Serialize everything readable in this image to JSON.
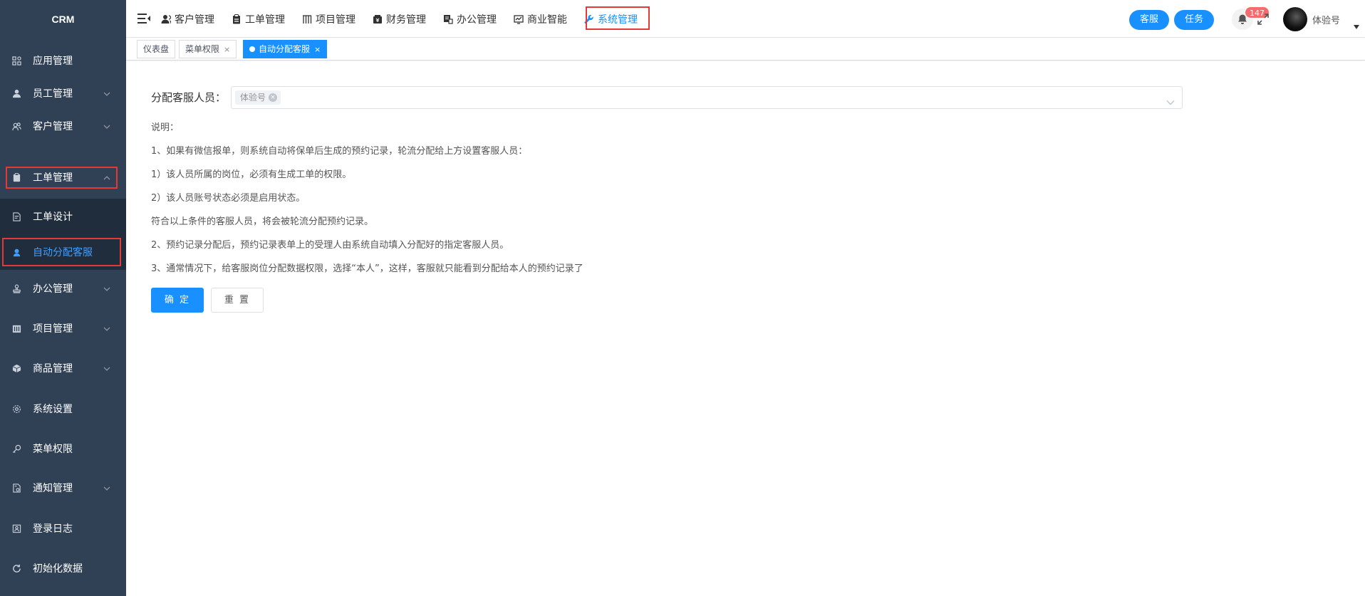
{
  "sidebar": {
    "brand": "CRM",
    "items": [
      {
        "label": "应用管理",
        "icon": "apps-grid-icon"
      },
      {
        "label": "员工管理",
        "icon": "user-icon"
      },
      {
        "label": "客户管理",
        "icon": "customers-icon"
      },
      {
        "label": "工单管理",
        "icon": "clipboard-icon"
      },
      {
        "label": "办公管理",
        "icon": "stamp-icon"
      },
      {
        "label": "项目管理",
        "icon": "building-icon"
      },
      {
        "label": "商品管理",
        "icon": "cube-icon"
      },
      {
        "label": "系统设置",
        "icon": "gear-icon"
      },
      {
        "label": "菜单权限",
        "icon": "key-icon"
      },
      {
        "label": "通知管理",
        "icon": "notice-icon"
      },
      {
        "label": "登录日志",
        "icon": "log-icon"
      },
      {
        "label": "初始化数据",
        "icon": "refresh-icon"
      }
    ],
    "submenu": [
      {
        "label": "工单设计",
        "icon": "form-design-icon"
      },
      {
        "label": "自动分配客服",
        "icon": "support-agent-icon"
      }
    ]
  },
  "topnav": {
    "items": [
      {
        "label": "客户管理",
        "icon": "customer-icon"
      },
      {
        "label": "工单管理",
        "icon": "clipboard-icon"
      },
      {
        "label": "项目管理",
        "icon": "project-icon"
      },
      {
        "label": "财务管理",
        "icon": "finance-icon"
      },
      {
        "label": "办公管理",
        "icon": "office-icon"
      },
      {
        "label": "商业智能",
        "icon": "bi-icon"
      },
      {
        "label": "系统管理",
        "icon": "wrench-icon"
      }
    ],
    "service_btn": "客服",
    "task_btn": "任务",
    "notification_count": "147",
    "user_name": "体验号"
  },
  "tags": [
    {
      "label": "仪表盘"
    },
    {
      "label": "菜单权限",
      "close": "×"
    },
    {
      "label": "自动分配客服",
      "close": "×"
    }
  ],
  "form": {
    "label": "分配客服人员：",
    "selected": "体验号",
    "remove": "×",
    "description": [
      "说明：",
      "1、如果有微信报单，则系统自动将保单后生成的预约记录，轮流分配给上方设置客服人员：",
      "1）该人员所属的岗位，必须有生成工单的权限。",
      "2）该人员账号状态必须是启用状态。",
      "符合以上条件的客服人员，将会被轮流分配预约记录。",
      "2、预约记录分配后，预约记录表单上的受理人由系统自动填入分配好的指定客服人员。",
      "3、通常情况下，给客服岗位分配数据权限，选择“本人”，这样，客服就只能看到分配给本人的预约记录了"
    ],
    "confirm": "确 定",
    "reset": "重 置"
  }
}
